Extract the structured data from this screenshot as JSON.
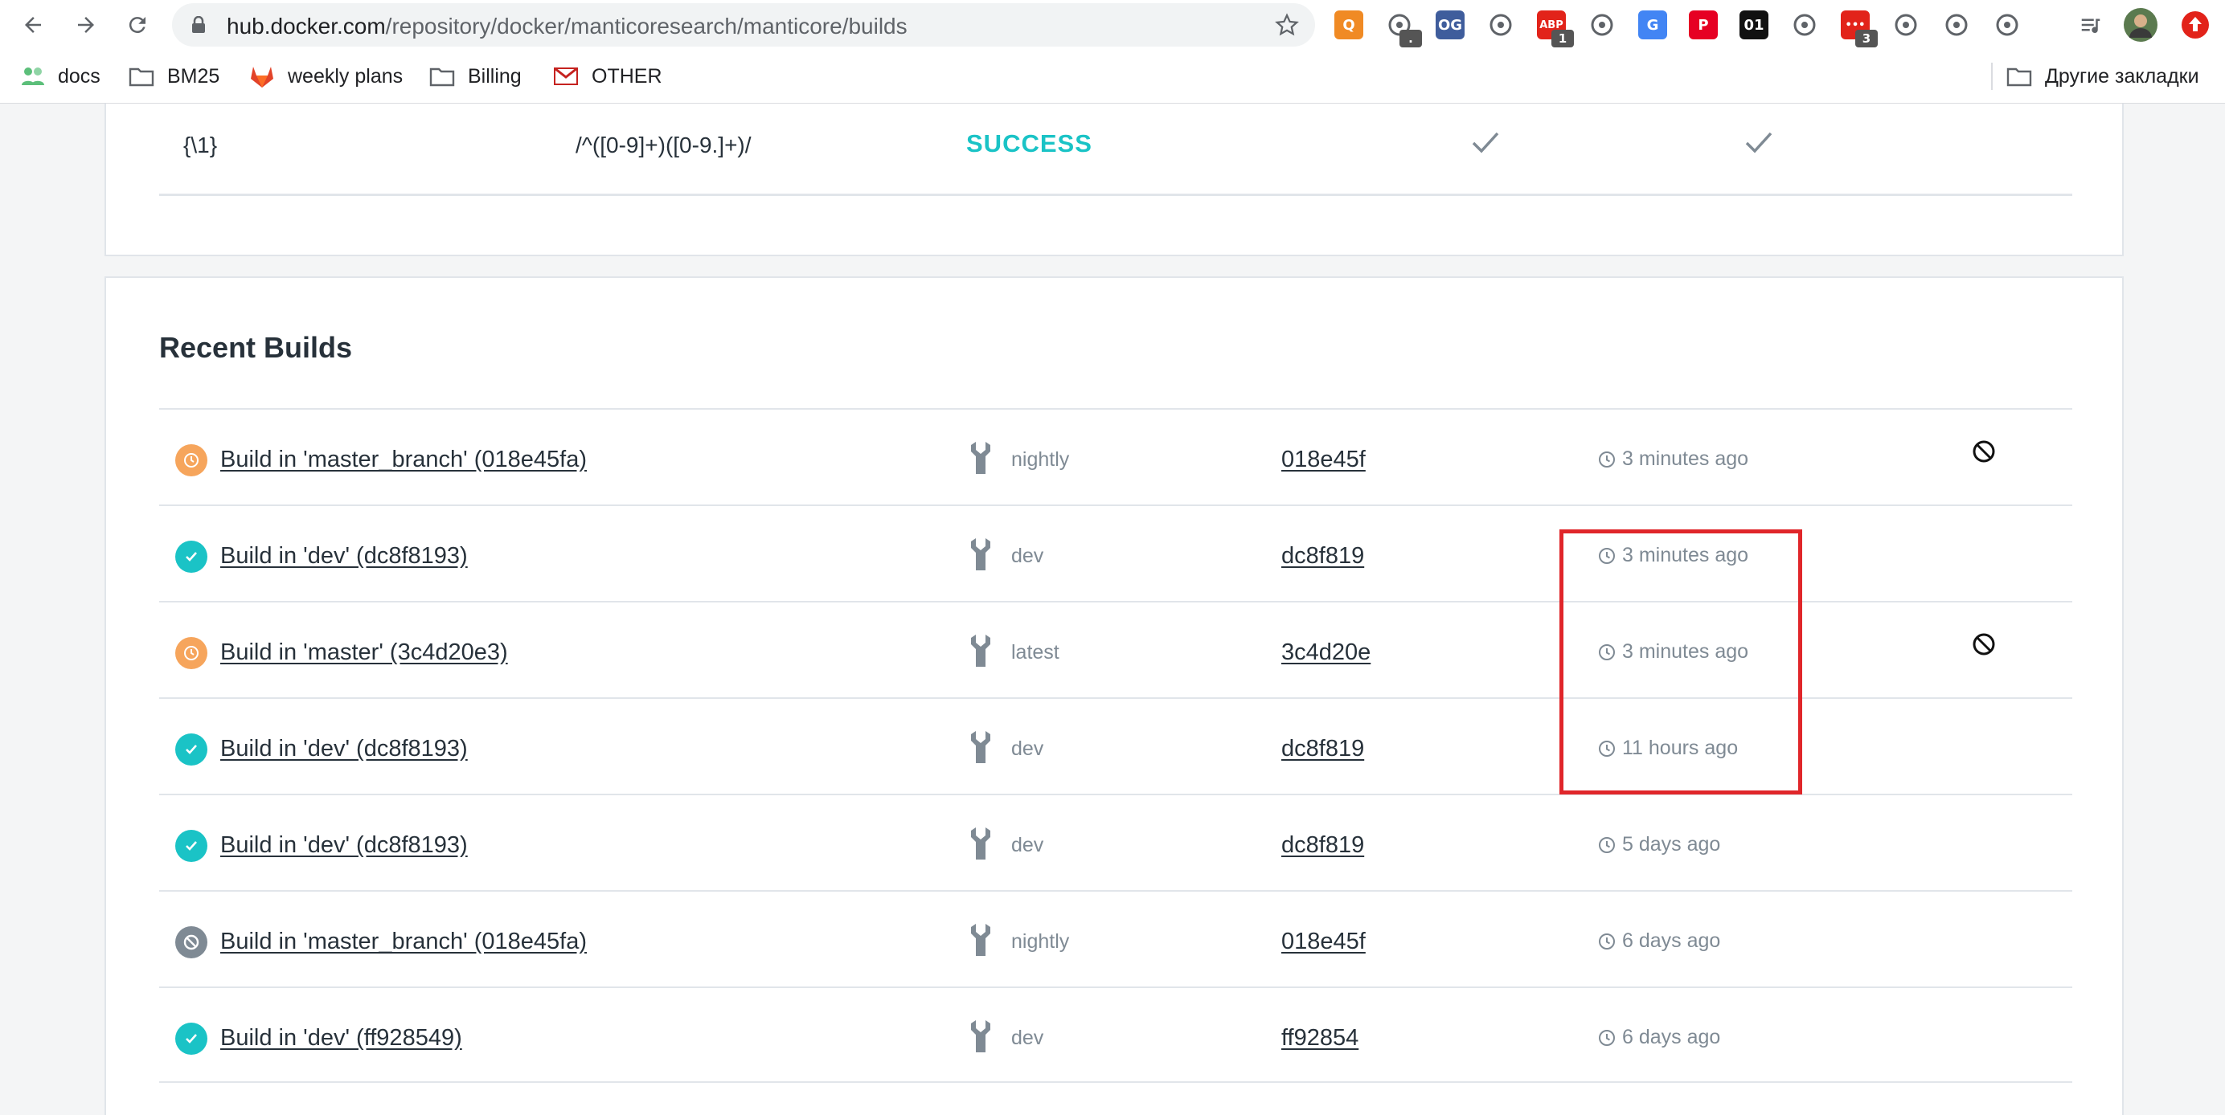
{
  "browser": {
    "url_host": "hub.docker.com",
    "url_path": "/repository/docker/manticoresearch/manticore/builds",
    "extensions": [
      {
        "icon": "search-ext-icon",
        "color": "#f08a24",
        "label": "Q"
      },
      {
        "icon": "eyedropper-ext-icon",
        "color": "#ffffff",
        "label": "",
        "badge": "."
      },
      {
        "icon": "og-ext-icon",
        "color": "#3f5d9c",
        "label": "OG"
      },
      {
        "icon": "checkmark-ext-icon",
        "color": "#ffffff",
        "label": ""
      },
      {
        "icon": "adblock-ext-icon",
        "color": "#e2231a",
        "label": "ABP",
        "badge": "1"
      },
      {
        "icon": "camera-ext-icon",
        "color": "#ffffff",
        "label": ""
      },
      {
        "icon": "translate-ext-icon",
        "color": "#4285f4",
        "label": "G"
      },
      {
        "icon": "pinterest-ext-icon",
        "color": "#e60023",
        "label": "P"
      },
      {
        "icon": "binary-ext-icon",
        "color": "#111111",
        "label": "01"
      },
      {
        "icon": "globe-ext-icon",
        "color": "#ffffff",
        "label": ""
      },
      {
        "icon": "dots-ext-icon",
        "color": "#e2231a",
        "label": "•••",
        "badge": "3"
      },
      {
        "icon": "speed-ext-icon",
        "color": "#ffffff",
        "label": ""
      },
      {
        "icon": "chick-ext-icon",
        "color": "#ffffff",
        "label": ""
      },
      {
        "icon": "gear-ext-icon",
        "color": "#ffffff",
        "label": ""
      }
    ],
    "bookmarks": [
      {
        "label": "docs",
        "icon": "people-icon"
      },
      {
        "label": "BM25",
        "icon": "folder-icon"
      },
      {
        "label": "weekly plans",
        "icon": "gitlab-icon"
      },
      {
        "label": "Billing",
        "icon": "folder-icon"
      },
      {
        "label": "OTHER",
        "icon": "gmail-icon"
      }
    ],
    "other_bookmarks": "Другие закладки"
  },
  "rule": {
    "tag": "{\\1}",
    "regex": "/^([0-9]+)([0-9.]+)/",
    "status": "SUCCESS"
  },
  "recent_builds": {
    "title": "Recent Builds",
    "rows": [
      {
        "status": "pending",
        "name": "Build in 'master_branch' (018e45fa)",
        "tag": "nightly",
        "commit": "018e45f",
        "time": "3 minutes ago",
        "cancel": true
      },
      {
        "status": "success",
        "name": "Build in 'dev' (dc8f8193)",
        "tag": "dev",
        "commit": "dc8f819",
        "time": "3 minutes ago",
        "cancel": false
      },
      {
        "status": "pending",
        "name": "Build in 'master' (3c4d20e3)",
        "tag": "latest",
        "commit": "3c4d20e",
        "time": "3 minutes ago",
        "cancel": true
      },
      {
        "status": "success",
        "name": "Build in 'dev' (dc8f8193)",
        "tag": "dev",
        "commit": "dc8f819",
        "time": "11 hours ago",
        "cancel": false
      },
      {
        "status": "success",
        "name": "Build in 'dev' (dc8f8193)",
        "tag": "dev",
        "commit": "dc8f819",
        "time": "5 days ago",
        "cancel": false
      },
      {
        "status": "canceled",
        "name": "Build in 'master_branch' (018e45fa)",
        "tag": "nightly",
        "commit": "018e45f",
        "time": "6 days ago",
        "cancel": false
      },
      {
        "status": "success",
        "name": "Build in 'dev' (ff928549)",
        "tag": "dev",
        "commit": "ff92854",
        "time": "6 days ago",
        "cancel": false
      }
    ]
  },
  "colors": {
    "success": "#1ac3c6",
    "pending": "#f6a55c",
    "canceled": "#7f8a94",
    "highlight": "#e0262a"
  }
}
